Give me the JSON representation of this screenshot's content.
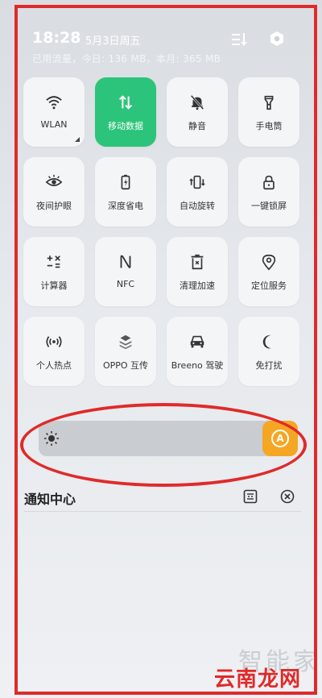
{
  "status_bar": {
    "time": "18:28",
    "date": "5月3日周五",
    "traffic": "已用流量，今日: 136 MB，本月: 365 MB"
  },
  "tiles": [
    {
      "label": "WLAN",
      "icon": "wifi-icon",
      "active": false
    },
    {
      "label": "移动数据",
      "icon": "mobile-data-icon",
      "active": true
    },
    {
      "label": "静音",
      "icon": "bell-off-icon",
      "active": false
    },
    {
      "label": "手电筒",
      "icon": "flashlight-icon",
      "active": false
    },
    {
      "label": "夜间护眼",
      "icon": "eye-icon",
      "active": false
    },
    {
      "label": "深度省电",
      "icon": "battery-icon",
      "active": false
    },
    {
      "label": "自动旋转",
      "icon": "rotate-icon",
      "active": false
    },
    {
      "label": "一键锁屏",
      "icon": "lock-icon",
      "active": false
    },
    {
      "label": "计算器",
      "icon": "calculator-icon",
      "active": false
    },
    {
      "label": "NFC",
      "icon": "nfc-icon",
      "active": false
    },
    {
      "label": "清理加速",
      "icon": "trash-icon",
      "active": false
    },
    {
      "label": "定位服务",
      "icon": "location-icon",
      "active": false
    },
    {
      "label": "个人热点",
      "icon": "hotspot-icon",
      "active": false
    },
    {
      "label": "OPPO 互传",
      "icon": "share-icon",
      "active": false
    },
    {
      "label": "Breeno 驾驶",
      "icon": "car-icon",
      "active": false
    },
    {
      "label": "免打扰",
      "icon": "moon-icon",
      "active": false
    }
  ],
  "brightness": {
    "auto_label": "A",
    "accent": "#f5a623"
  },
  "notifications": {
    "title": "通知中心"
  },
  "colors": {
    "active_tile": "#2cc47a",
    "highlight": "#e02a2a"
  },
  "watermark": {
    "line1": "智能家",
    "line2": "云南龙网"
  }
}
